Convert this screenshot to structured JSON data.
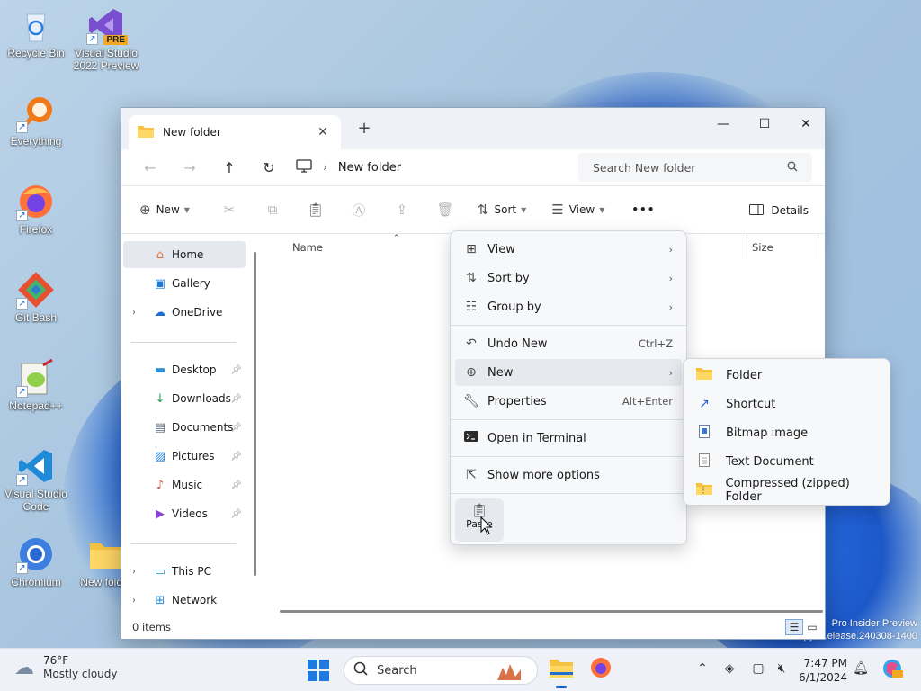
{
  "desktop": {
    "icons": [
      {
        "label": "Recycle Bin"
      },
      {
        "label": "Visual Studio 2022 Preview",
        "badge": "PRE"
      },
      {
        "label": "Everything"
      },
      {
        "label": "Firefox"
      },
      {
        "label": "Git Bash"
      },
      {
        "label": "Notepad++"
      },
      {
        "label": "Visual Studio Code"
      },
      {
        "label": "Chromium"
      },
      {
        "label": "New folder"
      }
    ],
    "watermark": {
      "line1": "Pro Insider Preview",
      "line2": "Evaluation copy. ...elease.240308-1400"
    }
  },
  "window": {
    "tab": {
      "title": "New folder",
      "close": "✕"
    },
    "new_tab": "+",
    "controls": {
      "minimize": "—",
      "maximize": "☐",
      "close": "✕"
    },
    "address": {
      "path": "New folder"
    },
    "search": {
      "placeholder": "Search New folder"
    },
    "commands": {
      "new": "New",
      "sort": "Sort",
      "view": "View",
      "more": "•••",
      "details": "Details"
    },
    "nav": {
      "home": "Home",
      "gallery": "Gallery",
      "onedrive": "OneDrive",
      "desktop": "Desktop",
      "downloads": "Downloads",
      "documents": "Documents",
      "pictures": "Pictures",
      "music": "Music",
      "videos": "Videos",
      "thispc": "This PC",
      "network": "Network"
    },
    "columns": {
      "name": "Name",
      "size": "Size"
    },
    "status": {
      "items": "0 items"
    }
  },
  "context_menu": {
    "items": [
      {
        "label": "View",
        "icon": "grid-icon"
      },
      {
        "label": "Sort by",
        "icon": "sort-icon"
      },
      {
        "label": "Group by",
        "icon": "list-icon"
      },
      {
        "label": "Undo New",
        "icon": "undo-icon",
        "shortcut": "Ctrl+Z"
      },
      {
        "label": "New",
        "icon": "plus-circle-icon"
      },
      {
        "label": "Properties",
        "icon": "wrench-icon",
        "shortcut": "Alt+Enter"
      },
      {
        "label": "Open in Terminal",
        "icon": "terminal-icon"
      },
      {
        "label": "Show more options",
        "icon": "share-icon"
      }
    ],
    "paste": "Paste"
  },
  "submenu_new": {
    "items": [
      {
        "label": "Folder",
        "icon": "folder-icon"
      },
      {
        "label": "Shortcut",
        "icon": "shortcut-icon"
      },
      {
        "label": "Bitmap image",
        "icon": "bitmap-icon"
      },
      {
        "label": "Text Document",
        "icon": "text-document-icon"
      },
      {
        "label": "Compressed (zipped) Folder",
        "icon": "zip-folder-icon"
      }
    ]
  },
  "taskbar": {
    "weather": {
      "temp": "76°F",
      "condition": "Mostly cloudy"
    },
    "search": "Search",
    "clock": {
      "time": "7:47 PM",
      "date": "6/1/2024"
    }
  },
  "colors": {
    "accent": "#0a60d0",
    "folder": "#f5c242",
    "window_bg": "#ffffff",
    "menu_bg": "#f7f8fa"
  }
}
